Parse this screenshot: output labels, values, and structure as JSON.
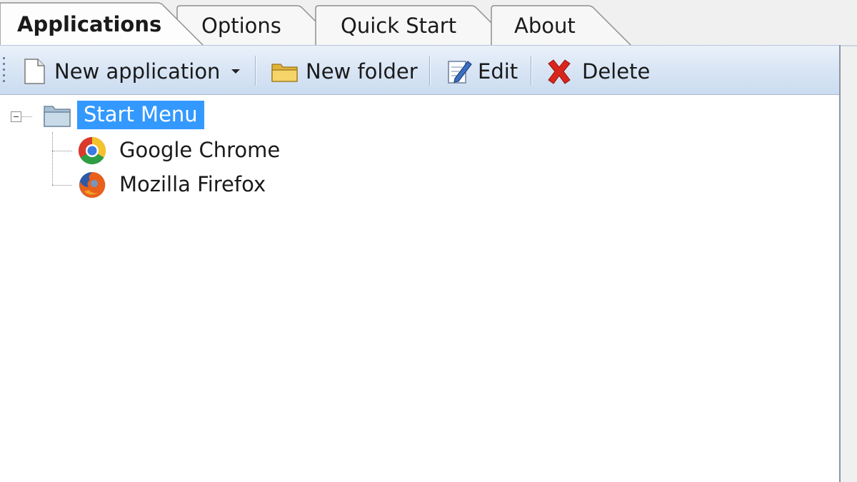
{
  "tabs": [
    {
      "label": "Applications",
      "active": true
    },
    {
      "label": "Options",
      "active": false
    },
    {
      "label": "Quick Start",
      "active": false
    },
    {
      "label": "About",
      "active": false
    }
  ],
  "toolbar": {
    "new_application": {
      "label": "New application",
      "icon": "document-icon"
    },
    "new_folder": {
      "label": "New folder",
      "icon": "folder-icon"
    },
    "edit": {
      "label": "Edit",
      "icon": "edit-pencil-icon"
    },
    "delete": {
      "label": "Delete",
      "icon": "delete-x-icon"
    }
  },
  "tree": {
    "root": {
      "label": "Start Menu",
      "selected": true,
      "expanded": true,
      "icon": "folder-icon"
    },
    "children": [
      {
        "label": "Google Chrome",
        "icon": "chrome-icon"
      },
      {
        "label": "Mozilla Firefox",
        "icon": "firefox-icon"
      }
    ]
  },
  "colors": {
    "selection": "#3399ff",
    "toolbar_gradient_top": "#eaf1fa",
    "toolbar_gradient_bottom": "#cbdcf0",
    "delete_red": "#d9261c"
  }
}
